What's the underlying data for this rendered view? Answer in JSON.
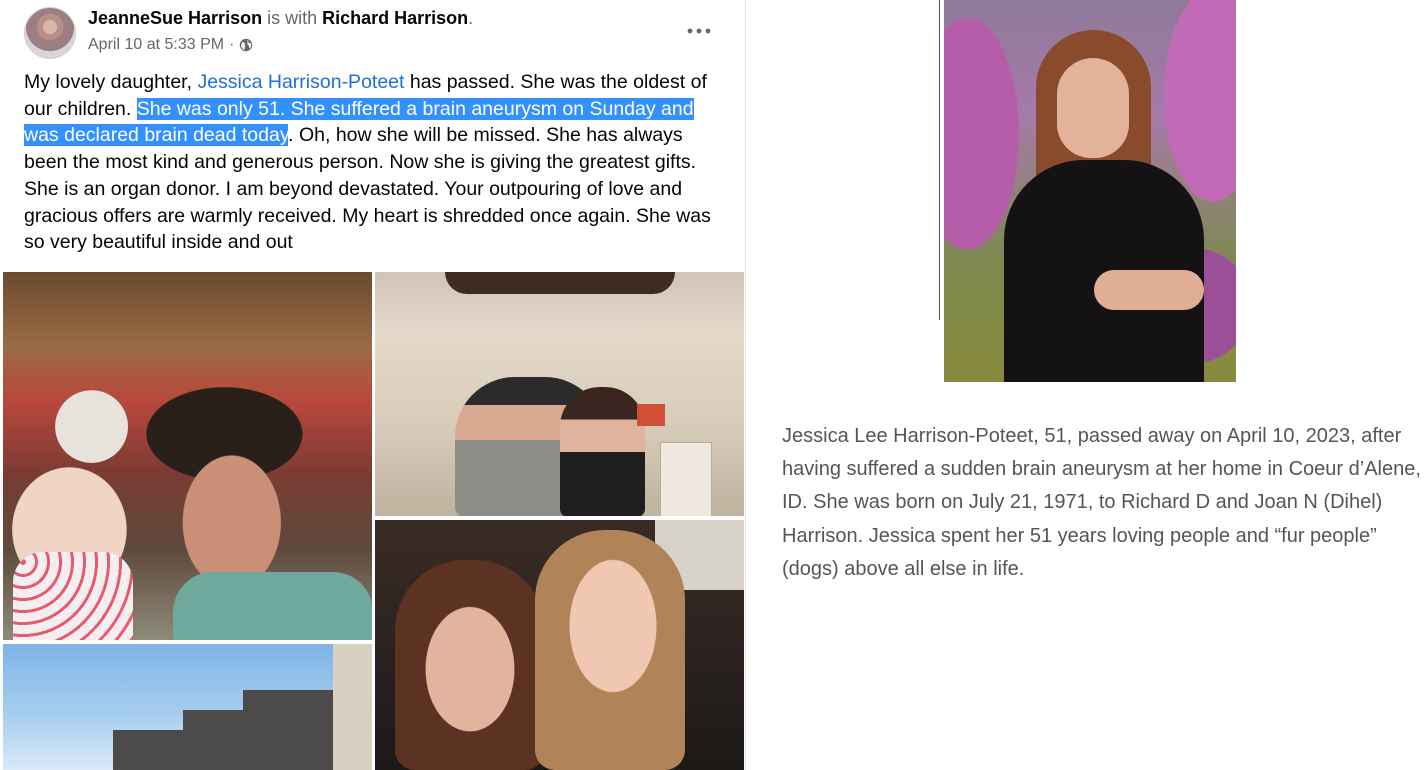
{
  "post": {
    "author": "JeanneSue Harrison",
    "with_text": "is with",
    "tagged": "Richard Harrison",
    "period": ".",
    "timestamp": "April 10 at 5:33 PM",
    "separator": "·",
    "audience_icon": "globe-icon",
    "more_icon": "more-options-icon",
    "text": {
      "part1": "My lovely daughter, ",
      "mention": "Jessica Harrison-Poteet",
      "part2": " has passed.  She was the oldest of our children. ",
      "highlighted": "She was only 51.  She suffered a brain aneurysm on Sunday and was declared brain dead today",
      "part3": ". Oh, how she will be missed.  She has always been the most kind and generous person. Now she is giving the greatest gifts.  She is an organ donor.  I am beyond devastated.  Your outpouring of love and gracious offers are warmly received.  My heart is shredded once again.  She was so very beautiful inside and out"
    },
    "photo_count": 4
  },
  "obituary": {
    "text": "Jessica Lee Harrison-Poteet, 51, passed away on April 10, 2023, after having suffered a sudden brain aneurysm at her home in Coeur d’Alene, ID. She was born on July 21, 1971, to Richard D and Joan N (Dihel) Harrison. Jessica spent her 51 years loving people and “fur people” (dogs) above all else in life."
  },
  "colors": {
    "link": "#216fdb",
    "selection": "#3390ff",
    "meta": "#65676b",
    "obit_text": "#555555"
  }
}
